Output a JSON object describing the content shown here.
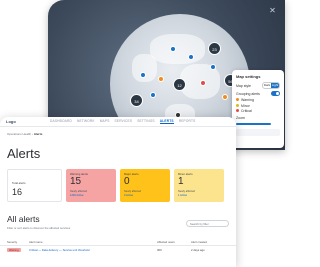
{
  "map": {
    "close_glyph": "✕",
    "clusters": [
      "12",
      "23",
      "34",
      "56"
    ],
    "settings": {
      "title": "Map settings",
      "view_label": "Map style",
      "view_options": [
        "Dark",
        "Light"
      ],
      "grouping_label": "Grouping alerts",
      "legend": [
        {
          "label": "Warning",
          "color": "#f28c1c"
        },
        {
          "label": "Minor",
          "color": "#e1b81c"
        },
        {
          "label": "Critical",
          "color": "#e14b4b"
        }
      ],
      "zoom_label": "Zoom"
    }
  },
  "nav": {
    "brand": "Logo",
    "items": [
      "DASHBOARD",
      "NETWORK",
      "MAPS",
      "SERVICES",
      "SETTINGS",
      "ALERTS",
      "REPORTS"
    ],
    "active_index": 5
  },
  "breadcrumb": {
    "parent": "Operations Health",
    "separator": "›",
    "current": "Alerts"
  },
  "page_title": "Alerts",
  "stats": {
    "total": {
      "label": "Total alerts",
      "value": "16"
    },
    "warning": {
      "label": "Warning alerts",
      "value": "15",
      "sub": "Newly affected",
      "link": "1230 Active"
    },
    "major": {
      "label": "Major alerts",
      "value": "0",
      "sub": "Newly affected",
      "link": "0 Active"
    },
    "minor": {
      "label": "Minor alerts",
      "value": "1",
      "sub": "Newly affected",
      "link": "1 Active"
    }
  },
  "all_alerts": {
    "title": "All alerts",
    "subtitle": "Filter or sort alerts to discover the affected services",
    "search_placeholder": "Search by filter",
    "columns": [
      "Severity",
      "Alert name",
      "Affected users",
      "Alert created"
    ],
    "rows": [
      {
        "severity": "Warning",
        "name": "Critical — Data delivery — Service unit threshold",
        "users": "300",
        "created": "2 days ago"
      }
    ]
  },
  "colors": {
    "accent": "#0b62c4",
    "warning_card": "#f6a3a3",
    "major_card": "#ffc21a",
    "minor_card": "#fbe48d",
    "map_bg": "#3d4a5c"
  }
}
